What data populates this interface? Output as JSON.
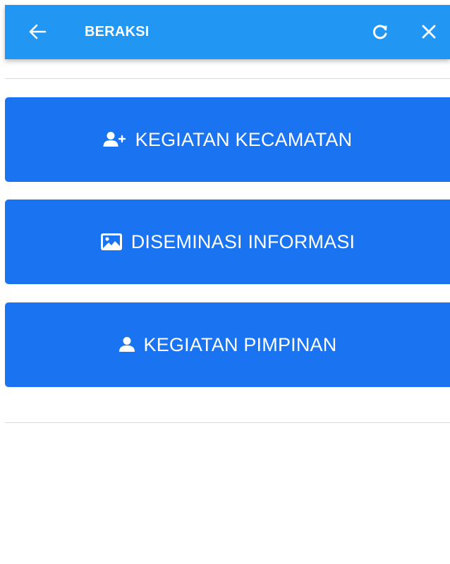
{
  "appbar": {
    "title": "BERAKSI",
    "back_icon": "arrow-left-icon",
    "refresh_icon": "refresh-icon",
    "close_icon": "close-icon",
    "background": "#2196f3"
  },
  "menu": {
    "button_color": "#1a73f0",
    "items": [
      {
        "label": "KEGIATAN KECAMATAN",
        "icon": "user-plus-icon"
      },
      {
        "label": "DISEMINASI INFORMASI",
        "icon": "image-icon"
      },
      {
        "label": "KEGIATAN PIMPINAN",
        "icon": "user-icon"
      }
    ]
  }
}
